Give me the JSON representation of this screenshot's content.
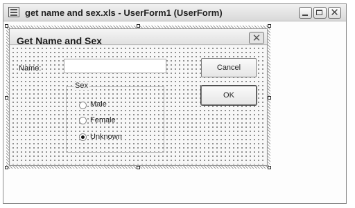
{
  "window": {
    "title": "get name and sex.xls - UserForm1 (UserForm)"
  },
  "form": {
    "title": "Get Name and Sex",
    "name_label": "Name:",
    "name_value": "",
    "sex_frame_label": "Sex",
    "options": [
      {
        "label": "Male",
        "checked": false
      },
      {
        "label": "Female",
        "checked": false
      },
      {
        "label": "Unknown",
        "checked": true
      }
    ],
    "cancel_label": "Cancel",
    "ok_label": "OK"
  }
}
